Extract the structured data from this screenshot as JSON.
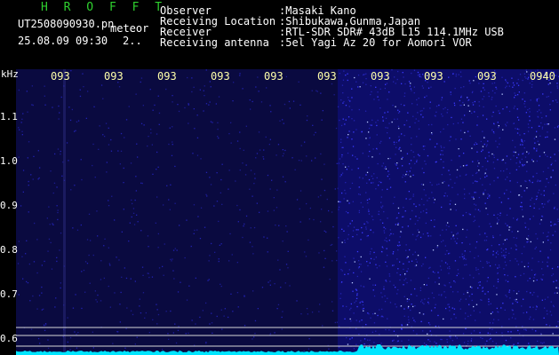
{
  "header": {
    "title": "H R O F F T",
    "filename": "UT2508090930.pn",
    "meteor_label": "meteor",
    "datetime": "25.08.09 09:30",
    "count": "2..",
    "labels": [
      "Observer",
      "Receiving Location",
      "Receiver",
      "Receiving antenna"
    ],
    "values": [
      ":Masaki Kano",
      ":Shibukawa,Gunma,Japan",
      ":RTL-SDR SDR# 43dB L15 114.1MHz USB",
      ":5el Yagi Az 20 for Aomori VOR"
    ]
  },
  "axis": {
    "unit": "kHz",
    "y_ticks": [
      "1.1",
      "1.0",
      "0.9",
      "0.8",
      "0.7",
      "0.6"
    ],
    "x_ticks": [
      "093",
      "093",
      "093",
      "093",
      "093",
      "093",
      "093",
      "093",
      "093",
      "0940"
    ]
  },
  "colors": {
    "background": "#000000",
    "spectrum_dark": "#0a0a40",
    "spectrum_bright": "#3a3aff",
    "signal_trace": "#00e5ff",
    "title_green": "#2fd02f",
    "tick_label": "#ffffaa"
  }
}
